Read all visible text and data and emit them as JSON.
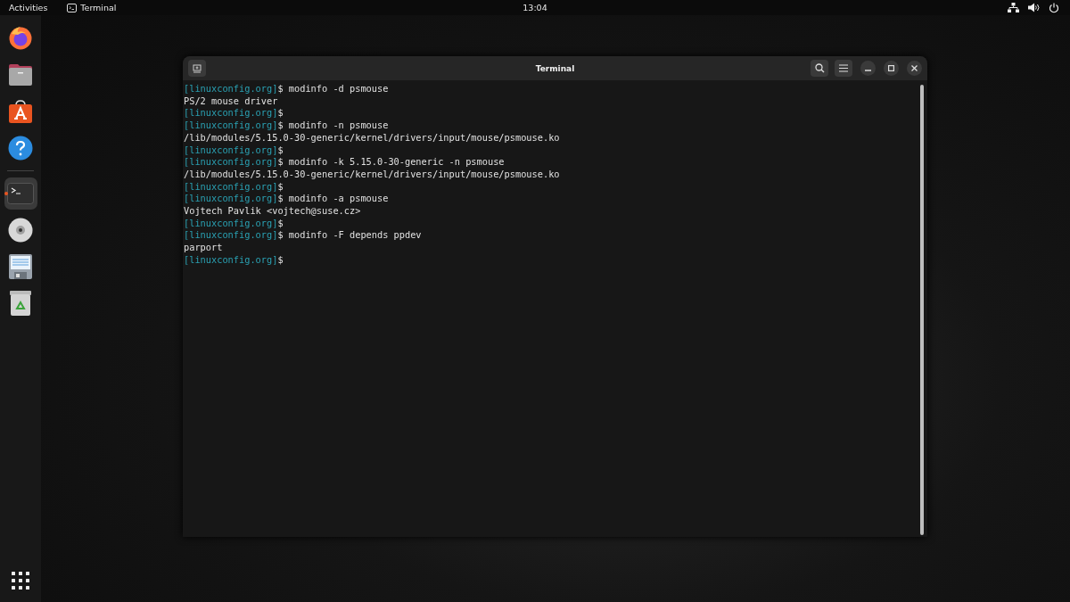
{
  "top_bar": {
    "activities": "Activities",
    "app_menu": "Terminal",
    "clock": "13:04"
  },
  "dock": {
    "items": [
      {
        "kind": "browser",
        "selected": false
      },
      {
        "kind": "files",
        "selected": false
      },
      {
        "kind": "store",
        "selected": false
      },
      {
        "kind": "help",
        "selected": false
      },
      {
        "kind": "terminal",
        "selected": true
      },
      {
        "kind": "disc",
        "selected": false
      },
      {
        "kind": "document",
        "selected": false
      },
      {
        "kind": "trash",
        "selected": false
      }
    ]
  },
  "window": {
    "title": "Terminal",
    "lines": [
      {
        "prompt": "[linuxconfig.org]",
        "text": "$ modinfo -d psmouse"
      },
      {
        "text": "PS/2 mouse driver"
      },
      {
        "prompt": "[linuxconfig.org]",
        "text": "$"
      },
      {
        "prompt": "[linuxconfig.org]",
        "text": "$ modinfo -n psmouse"
      },
      {
        "text": "/lib/modules/5.15.0-30-generic/kernel/drivers/input/mouse/psmouse.ko"
      },
      {
        "prompt": "[linuxconfig.org]",
        "text": "$"
      },
      {
        "prompt": "[linuxconfig.org]",
        "text": "$ modinfo -k 5.15.0-30-generic -n psmouse"
      },
      {
        "text": "/lib/modules/5.15.0-30-generic/kernel/drivers/input/mouse/psmouse.ko"
      },
      {
        "prompt": "[linuxconfig.org]",
        "text": "$"
      },
      {
        "prompt": "[linuxconfig.org]",
        "text": "$ modinfo -a psmouse"
      },
      {
        "text": "Vojtech Pavlik <vojtech@suse.cz>"
      },
      {
        "prompt": "[linuxconfig.org]",
        "text": "$"
      },
      {
        "prompt": "[linuxconfig.org]",
        "text": "$ modinfo -F depends ppdev"
      },
      {
        "text": "parport"
      },
      {
        "prompt": "[linuxconfig.org]",
        "text": "$"
      }
    ]
  }
}
